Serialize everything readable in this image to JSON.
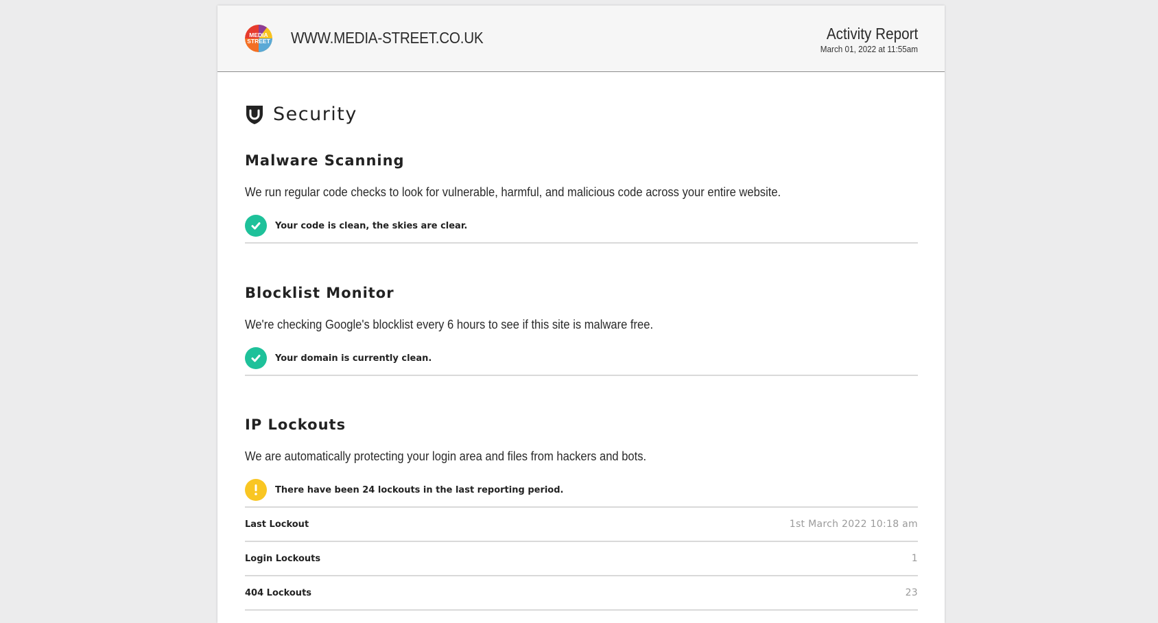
{
  "header": {
    "site_url": "WWW.MEDIA-STREET.CO.UK",
    "report_title": "Activity Report",
    "report_date": "March 01, 2022 at 11:55am",
    "logo_text_line1": "MEDIA",
    "logo_text_line2": "STREET"
  },
  "security": {
    "title": "Security",
    "icon": "shield-icon"
  },
  "sections": [
    {
      "title": "Malware Scanning",
      "description": "We run regular code checks to look for vulnerable, harmful, and malicious code across your entire website.",
      "status": "ok",
      "status_icon": "check-icon",
      "status_text": "Your code is clean, the skies are clear."
    },
    {
      "title": "Blocklist Monitor",
      "description": "We're checking Google's blocklist every 6 hours to see if this site is malware free.",
      "status": "ok",
      "status_icon": "check-icon",
      "status_text": "Your domain is currently clean."
    },
    {
      "title": "IP Lockouts",
      "description": "We are automatically protecting your login area and files from hackers and bots.",
      "status": "warning",
      "status_icon": "exclamation-icon",
      "status_text": "There have been 24 lockouts in the last reporting period.",
      "rows": [
        {
          "label": "Last Lockout",
          "value": "1st March 2022 10:18 am"
        },
        {
          "label": "Login Lockouts",
          "value": "1"
        },
        {
          "label": "404 Lockouts",
          "value": "23"
        }
      ]
    }
  ],
  "colors": {
    "ok": "#1ec19a",
    "warning": "#f9c623",
    "divider": "#d9d9d9",
    "muted_value": "#9a9a9a"
  }
}
